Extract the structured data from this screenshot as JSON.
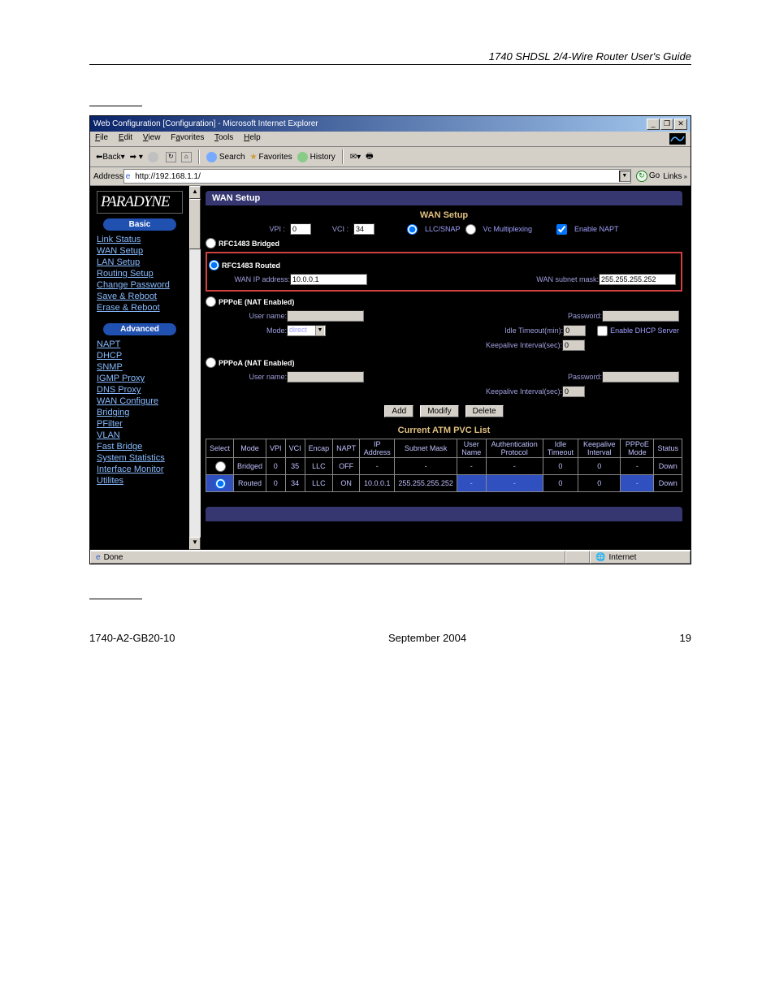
{
  "header": "1740 SHDSL 2/4-Wire Router User's Guide",
  "window": {
    "title": "Web Configuration [Configuration] - Microsoft Internet Explorer",
    "menu": {
      "file": "File",
      "edit": "Edit",
      "view": "View",
      "fav": "Favorites",
      "tools": "Tools",
      "help": "Help"
    },
    "toolbar": {
      "back": "Back",
      "search": "Search",
      "favorites": "Favorites",
      "history": "History"
    },
    "address_label": "Address",
    "address_value": "http://192.168.1.1/",
    "go": "Go",
    "links": "Links"
  },
  "sidebar": {
    "logo": "PARADYNE",
    "basic_head": "Basic",
    "basic": [
      "Link Status",
      "WAN Setup",
      "LAN Setup",
      "Routing Setup",
      "Change Password",
      "Save & Reboot",
      "Erase & Reboot"
    ],
    "adv_head": "Advanced",
    "advanced": [
      "NAPT",
      "DHCP",
      "SNMP",
      "IGMP Proxy",
      "DNS Proxy",
      "WAN Configure",
      "Bridging",
      "PFilter",
      "VLAN",
      "Fast Bridge",
      "System Statistics",
      "Interface Monitor",
      "Utilites"
    ]
  },
  "form": {
    "section": "WAN Setup",
    "title": "WAN Setup",
    "vpi_label": "VPI :",
    "vpi": "0",
    "vci_label": "VCI :",
    "vci": "34",
    "encap_llc": "LLC/SNAP",
    "encap_vc": "Vc Multiplexing",
    "enable_napt": "Enable NAPT",
    "rfc_bridged": "RFC1483 Bridged",
    "rfc_routed": "RFC1483 Routed",
    "wan_ip_label": "WAN IP address:",
    "wan_ip": "10.0.0.1",
    "wan_mask_label": "WAN subnet mask:",
    "wan_mask": "255.255.255.252",
    "pppoe_head": "PPPoE (NAT Enabled)",
    "user_label": "User name:",
    "pass_label": "Password:",
    "mode_label": "Mode:",
    "mode_val": "direct",
    "idle_label": "Idle Timeout(min):",
    "idle": "0",
    "dhcp_server": "Enable DHCP Server",
    "keep_label": "Keepalive Interval(sec):",
    "keep": "0",
    "pppoa_head": "PPPoA (NAT Enabled)",
    "keep2": "0",
    "add": "Add",
    "modify": "Modify",
    "delete": "Delete",
    "atm_title": "Current ATM PVC List",
    "atm_headers": [
      "Select",
      "Mode",
      "VPI",
      "VCI",
      "Encap",
      "NAPT",
      "IP Address",
      "Subnet Mask",
      "User Name",
      "Authentication Protocol",
      "Idle Timeout",
      "Keepalive Interval",
      "PPPoE Mode",
      "Status"
    ],
    "atm_rows": [
      {
        "sel": false,
        "mode": "Bridged",
        "vpi": "0",
        "vci": "35",
        "encap": "LLC",
        "napt": "OFF",
        "ip": "-",
        "mask": "-",
        "user": "-",
        "auth": "-",
        "idle": "0",
        "keep": "0",
        "pppoe": "-",
        "status": "Down"
      },
      {
        "sel": true,
        "mode": "Routed",
        "vpi": "0",
        "vci": "34",
        "encap": "LLC",
        "napt": "ON",
        "ip": "10.0.0.1",
        "mask": "255.255.255.252",
        "user": "-",
        "auth": "-",
        "idle": "0",
        "keep": "0",
        "pppoe": "-",
        "status": "Down"
      }
    ]
  },
  "statusbar": {
    "done": "Done",
    "zone": "Internet"
  },
  "footer": {
    "left": "1740-A2-GB20-10",
    "center": "September 2004",
    "right": "19"
  }
}
